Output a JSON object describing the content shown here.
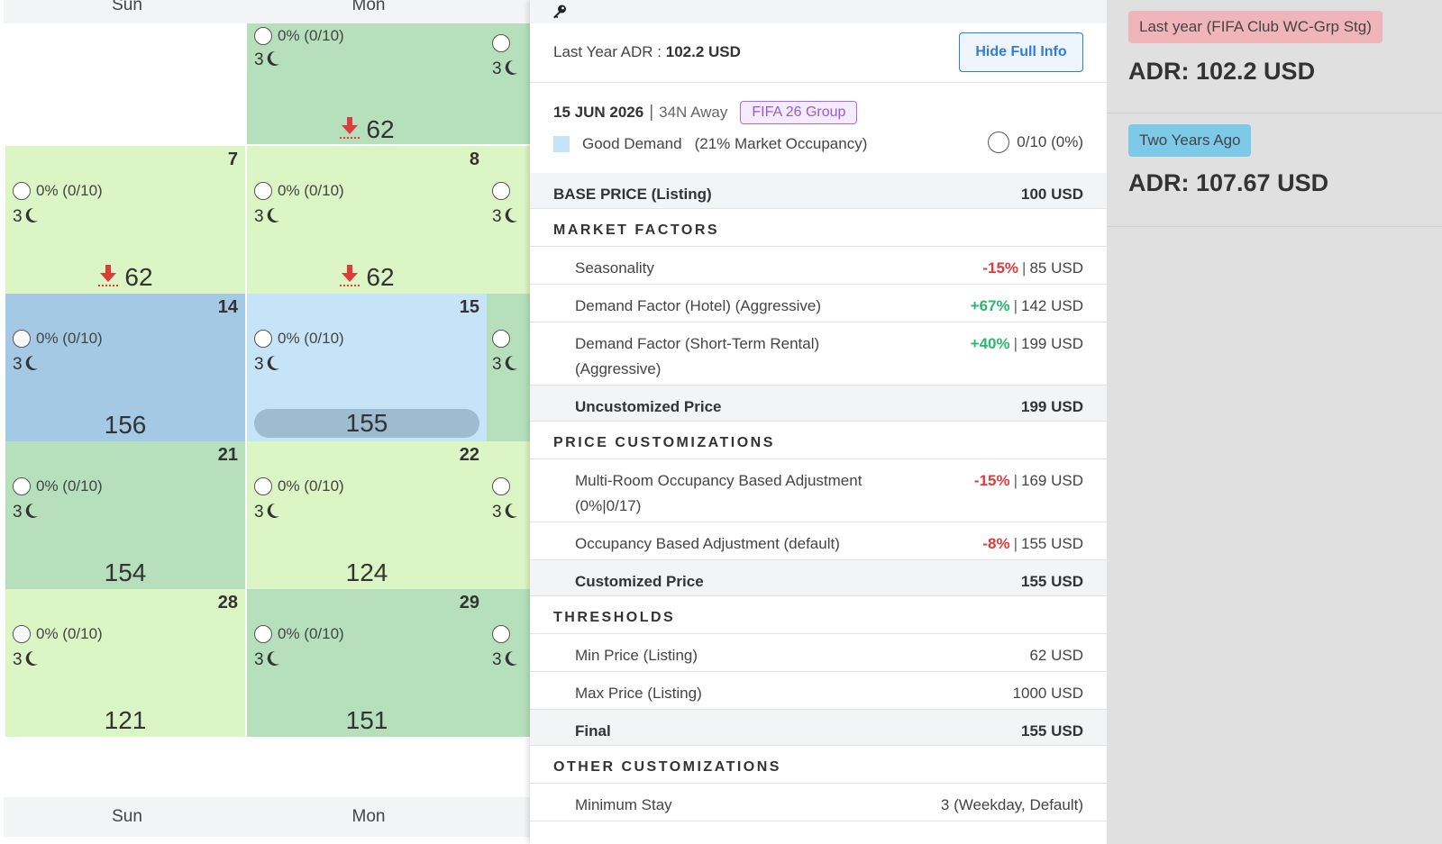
{
  "calendar": {
    "header_days": [
      "Sun",
      "Mon"
    ],
    "footer_days": [
      "Sun",
      "Mon"
    ],
    "rows": [
      {
        "sun": {
          "day": "",
          "occupancy": "",
          "stay": "",
          "price": "",
          "color": "white"
        },
        "mon": {
          "day": "",
          "occupancy": "0% (0/10)",
          "stay": "3",
          "price": "62",
          "color": "green",
          "arrow": true
        }
      },
      {
        "sun": {
          "day": "7",
          "occupancy": "0% (0/10)",
          "stay": "3",
          "price": "62",
          "color": "lgreen",
          "arrow": true
        },
        "mon": {
          "day": "8",
          "occupancy": "0% (0/10)",
          "stay": "3",
          "price": "62",
          "color": "lgreen",
          "arrow": true
        }
      },
      {
        "sun": {
          "day": "14",
          "occupancy": "0% (0/10)",
          "stay": "3",
          "price": "156",
          "color": "blue"
        },
        "mon": {
          "day": "15",
          "occupancy": "0% (0/10)",
          "stay": "3",
          "price": "155",
          "color": "lblue",
          "selected": true
        }
      },
      {
        "sun": {
          "day": "21",
          "occupancy": "0% (0/10)",
          "stay": "3",
          "price": "154",
          "color": "green"
        },
        "mon": {
          "day": "22",
          "occupancy": "0% (0/10)",
          "stay": "3",
          "price": "124",
          "color": "lgreen"
        }
      },
      {
        "sun": {
          "day": "28",
          "occupancy": "0% (0/10)",
          "stay": "3",
          "price": "121",
          "color": "lgreen"
        },
        "mon": {
          "day": "29",
          "occupancy": "0% (0/10)",
          "stay": "3",
          "price": "151",
          "color": "green"
        }
      }
    ],
    "peek_stay": "3"
  },
  "panel": {
    "last_year_adr_label": "Last Year ADR :",
    "last_year_adr_value": "102.2 USD",
    "hide_button": "Hide Full Info",
    "date": "15 JUN 2026",
    "away": "34N Away",
    "event_tag": "FIFA 26 Group",
    "demand_label": "Good Demand",
    "market_occupancy": "(21% Market Occupancy)",
    "occupancy": "0/10 (0%)",
    "demand_color": "#c6e4f8",
    "rows": [
      {
        "type": "total",
        "label": "BASE PRICE (Listing)",
        "value": "100 USD",
        "first": true
      },
      {
        "type": "section",
        "label": "MARKET FACTORS"
      },
      {
        "type": "item",
        "label": "Seasonality",
        "pct": "-15%",
        "sign": "neg",
        "value": "85 USD"
      },
      {
        "type": "item",
        "label": "Demand Factor (Hotel) (Aggressive)",
        "pct": "+67%",
        "sign": "pos",
        "value": "142 USD"
      },
      {
        "type": "item",
        "tall": true,
        "label": "Demand Factor (Short-Term Rental)",
        "label2": "(Aggressive)",
        "pct": "+40%",
        "sign": "pos",
        "value": "199 USD"
      },
      {
        "type": "total",
        "label": "Uncustomized Price",
        "value": "199 USD"
      },
      {
        "type": "section",
        "label": "PRICE CUSTOMIZATIONS"
      },
      {
        "type": "item",
        "tall": true,
        "label": "Multi-Room Occupancy Based Adjustment",
        "label2": "(0%|0/17)",
        "pct": "-15%",
        "sign": "neg",
        "value": "169 USD"
      },
      {
        "type": "item",
        "label": "Occupancy Based Adjustment (default)",
        "pct": "-8%",
        "sign": "neg",
        "value": "155 USD"
      },
      {
        "type": "total",
        "label": "Customized Price",
        "value": "155 USD"
      },
      {
        "type": "section",
        "label": "THRESHOLDS"
      },
      {
        "type": "item",
        "label": "Min Price (Listing)",
        "value": "62 USD"
      },
      {
        "type": "item",
        "label": "Max Price (Listing)",
        "value": "1000 USD"
      },
      {
        "type": "total",
        "label": "Final",
        "value": "155 USD"
      },
      {
        "type": "section",
        "label": "OTHER CUSTOMIZATIONS"
      },
      {
        "type": "item",
        "label": "Minimum Stay",
        "value": "3 (Weekday, Default)"
      }
    ]
  },
  "sidebar": {
    "blocks": [
      {
        "badge": "Last year (FIFA Club WC-Grp Stg)",
        "badge_color": "#f0b5b8",
        "adr": "ADR: 102.2 USD"
      },
      {
        "badge": "Two Years Ago",
        "badge_color": "#7cc9e8",
        "adr": "ADR: 107.67 USD"
      }
    ]
  },
  "colors": {
    "green": "#b6e0bc",
    "light_green": "#dcf5c4",
    "blue": "#a4c9e4",
    "light_blue": "#c6e4f8",
    "negative": "#e03b3b",
    "positive": "#2bb673",
    "accent": "#2f7ed8",
    "event_tag": "#9b58d6"
  }
}
